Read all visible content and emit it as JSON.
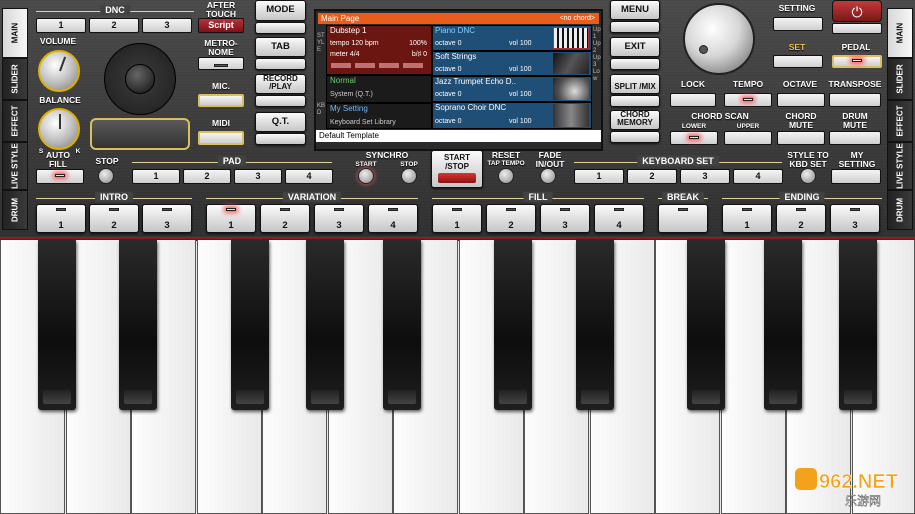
{
  "side_tabs": {
    "left": [
      "MAIN",
      "SLIDER",
      "EFFECT",
      "LIVE STYLE",
      "DRUM"
    ],
    "right": [
      "MAIN",
      "SLIDER",
      "EFFECT",
      "LIVE STYLE",
      "DRUM"
    ]
  },
  "dnc": {
    "label": "DNC",
    "buttons": [
      "1",
      "2",
      "3"
    ]
  },
  "after_touch": {
    "label": "AFTER TOUCH",
    "value": "Script"
  },
  "volume_label": "VOLUME",
  "balance_label": "BALANCE",
  "balance_s": "S",
  "balance_k": "K",
  "buttons": {
    "metronome": "METRO-NOME",
    "mic": "MIC.",
    "midi": "MIDI",
    "mode": "MODE",
    "tab": "TAB",
    "record": "RECORD /PLAY",
    "qt": "Q.T.",
    "menu": "MENU",
    "exit": "EXIT",
    "split_mix": "SPLIT /MIX",
    "chord_memory": "CHORD MEMORY",
    "setting": "SETTING",
    "set": "SET",
    "pedal": "PEDAL",
    "lock": "LOCK",
    "tempo": "TEMPO",
    "octave": "OCTAVE",
    "transpose": "TRANSPOSE",
    "chord_scan": "CHORD SCAN",
    "lower": "LOWER",
    "upper": "UPPER",
    "chord_mute": "CHORD MUTE",
    "drum_mute": "DRUM MUTE",
    "auto_fill": "AUTO FILL",
    "stop": "STOP",
    "synchro": "SYNCHRO",
    "synchro_start": "START",
    "synchro_stop": "STOP",
    "start_stop": "START /STOP",
    "reset": "RESET",
    "tap_tempo": "TAP TEMPO",
    "fade": "FADE IN/OUT",
    "style_to_kbd": "STYLE TO KBD SET",
    "my_setting": "MY SETTING"
  },
  "pad": {
    "label": "PAD",
    "buttons": [
      "1",
      "2",
      "3",
      "4"
    ]
  },
  "keyboard_set": {
    "label": "KEYBOARD SET",
    "buttons": [
      "1",
      "2",
      "3",
      "4"
    ]
  },
  "intro": {
    "label": "INTRO",
    "buttons": [
      "1",
      "2",
      "3"
    ]
  },
  "variation": {
    "label": "VARIATION",
    "buttons": [
      "1",
      "2",
      "3",
      "4"
    ]
  },
  "fill": {
    "label": "FILL",
    "buttons": [
      "1",
      "2",
      "3",
      "4"
    ]
  },
  "break": {
    "label": "BREAK",
    "buttons": [
      "1"
    ]
  },
  "ending": {
    "label": "ENDING",
    "buttons": [
      "1",
      "2",
      "3"
    ]
  },
  "screen": {
    "title": "Main Page",
    "chord": "<no chord>",
    "style_name": "Dubstep 1",
    "tempo": "tempo 120 bpm",
    "percent": "100%",
    "meter": "meter 4/4",
    "bsharp": "b/♯ 0",
    "normal": "Normal",
    "system": "System (Q.T.)",
    "my_setting": "My Setting",
    "kbd_library": "Keyboard Set Library",
    "part1": {
      "name": "Piano DNC",
      "octave": "octave 0",
      "vol": "vol 100"
    },
    "part2": {
      "name": "Soft Strings",
      "octave": "octave 0",
      "vol": "vol 100"
    },
    "part3": {
      "name": "Jazz Trumpet Echo D..",
      "octave": "octave 0",
      "vol": "vol 100"
    },
    "part4": {
      "name": "Soprano Choir DNC",
      "octave": "octave 0",
      "vol": "vol 100"
    },
    "left_vert": "STYLE",
    "left_vert2": "KBD",
    "right_vert": "Up 1 Up 2 Up 3 Low",
    "footer": "Default Template"
  },
  "watermark": {
    "main": "962.NET",
    "sub": "乐游网"
  },
  "colors": {
    "accent": "#e85d1c",
    "led": "#ff5a5a",
    "screen_blue": "#1f4e77",
    "screen_red": "#6b1610",
    "group_line": "#e2d29a"
  }
}
